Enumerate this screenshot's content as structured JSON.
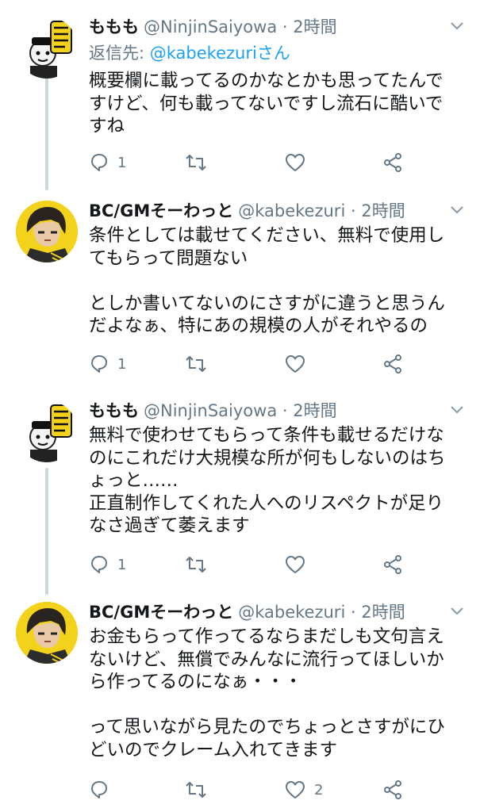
{
  "tweets": [
    {
      "display_name": "ももも",
      "handle": "@NinjinSaiyowa",
      "separator": "·",
      "time": "2時間",
      "reply_to": {
        "prefix": "返信先: ",
        "mention": "@kabekezuriさん"
      },
      "text": "概要欄に載ってるのかなとかも思ってたんで\nすけど、何も載ってないですし流石に酷いで\nすね",
      "reply_count": "1",
      "retweet_count": "",
      "like_count": "",
      "avatar_icon": "plush-figure-avatar-icon"
    },
    {
      "display_name": "BC/GMそーわっと",
      "handle": "@kabekezuri",
      "separator": "·",
      "time": "2時間",
      "text": "条件としては載せてください、無料で使用し\nてもらって問題ない\n\nとしか書いてないのにさすがに違うと思うん\nだよなぁ、特にあの規模の人がそれやるの",
      "reply_count": "1",
      "retweet_count": "",
      "like_count": "",
      "avatar_icon": "anime-character-avatar-icon"
    },
    {
      "display_name": "ももも",
      "handle": "@NinjinSaiyowa",
      "separator": "·",
      "time": "2時間",
      "text": "無料で使わせてもらって条件も載せるだけな\nのにこれだけ大規模な所が何もしないのはち\nょっと……\n正直制作してくれた人へのリスペクトが足り\nなさ過ぎて萎えます",
      "reply_count": "1",
      "retweet_count": "",
      "like_count": "",
      "avatar_icon": "plush-figure-avatar-icon"
    },
    {
      "display_name": "BC/GMそーわっと",
      "handle": "@kabekezuri",
      "separator": "·",
      "time": "2時間",
      "text": "お金もらって作ってるならまだしも文句言え\nないけど、無償でみんなに流行ってほしいか\nら作ってるのになぁ・・・\n\nって思いながら見たのでちょっとさすがにひ\nどいのでクレーム入れてきます",
      "reply_count": "",
      "retweet_count": "",
      "like_count": "2",
      "avatar_icon": "anime-character-avatar-icon"
    }
  ],
  "colors": {
    "text": "#14171a",
    "secondary": "#657786",
    "link": "#1da1f2",
    "thread_line": "#ccd6dd",
    "avatar_yellow": "#f2d21b"
  }
}
